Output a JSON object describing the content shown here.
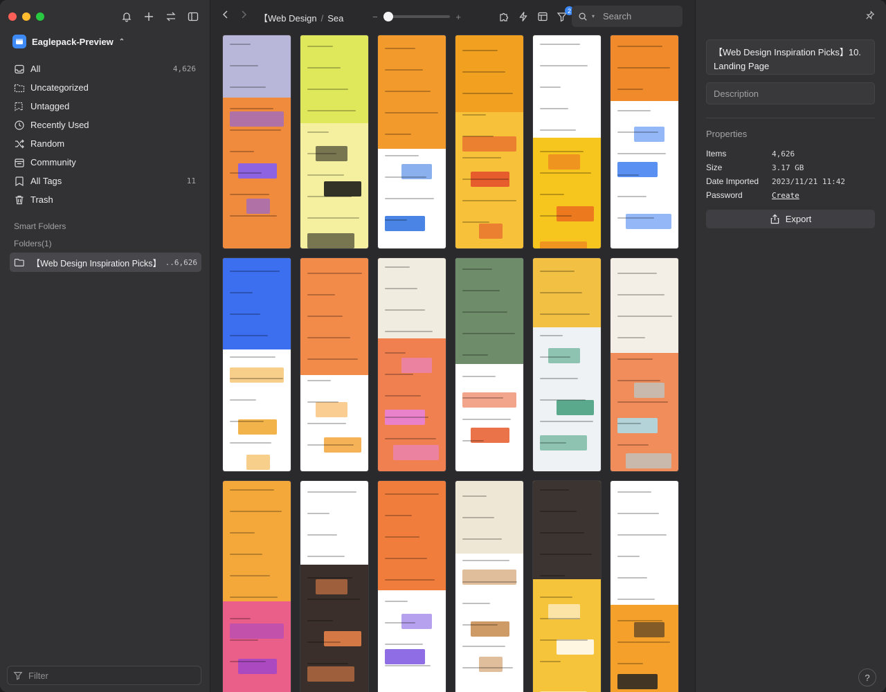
{
  "sidebar": {
    "library_name": "Eaglepack-Preview",
    "items": [
      {
        "label": "All",
        "count": "4,626",
        "icon": "inbox-icon"
      },
      {
        "label": "Uncategorized",
        "count": "",
        "icon": "folder-dashed-icon"
      },
      {
        "label": "Untagged",
        "count": "",
        "icon": "tag-dashed-icon"
      },
      {
        "label": "Recently Used",
        "count": "",
        "icon": "clock-icon"
      },
      {
        "label": "Random",
        "count": "",
        "icon": "shuffle-icon"
      },
      {
        "label": "Community",
        "count": "",
        "icon": "community-icon"
      },
      {
        "label": "All Tags",
        "count": "11",
        "icon": "tag-icon"
      },
      {
        "label": "Trash",
        "count": "",
        "icon": "trash-icon"
      }
    ],
    "smart_folders_label": "Smart Folders",
    "folders_label": "Folders(1)",
    "folder": {
      "label": "【Web Design Inspiration Picks】",
      "count": "..6,626"
    },
    "filter_placeholder": "Filter"
  },
  "toolbar": {
    "breadcrumb": [
      "【Web Design",
      "Sea"
    ],
    "zoom_level": 0.08,
    "filter_badge": "2",
    "search_placeholder": "Search"
  },
  "grid": {
    "thumbnails": [
      {
        "theme": [
          "#b9b7d9",
          "#f08a3c"
        ],
        "accent": "#7b5cff"
      },
      {
        "theme": [
          "#dfe85a",
          "#f5f0a0"
        ],
        "accent": "#111111"
      },
      {
        "theme": [
          "#f39a2c",
          "#ffffff"
        ],
        "accent": "#2a6fe0"
      },
      {
        "theme": [
          "#f2a020",
          "#f7c23a"
        ],
        "accent": "#e34a2a"
      },
      {
        "theme": [
          "#ffffff",
          "#f6c51e"
        ],
        "accent": "#ea6b1f"
      },
      {
        "theme": [
          "#f08a2a",
          "#ffffff"
        ],
        "accent": "#3c7cf0"
      },
      {
        "theme": [
          "#3b6ff0",
          "#ffffff"
        ],
        "accent": "#f0a62a"
      },
      {
        "theme": [
          "#f28a4a",
          "#ffffff"
        ],
        "accent": "#f5a53a"
      },
      {
        "theme": [
          "#f1ece0",
          "#f08050"
        ],
        "accent": "#e883e0"
      },
      {
        "theme": [
          "#6f8c6a",
          "#ffffff"
        ],
        "accent": "#e85b2a"
      },
      {
        "theme": [
          "#f2c144",
          "#eef2f5"
        ],
        "accent": "#3f9c7a"
      },
      {
        "theme": [
          "#f4efe6",
          "#f08d5a"
        ],
        "accent": "#a9dff0"
      },
      {
        "theme": [
          "#f5a83a",
          "#ea5e8a"
        ],
        "accent": "#a047c9"
      },
      {
        "theme": [
          "#ffffff",
          "#3a2f2a"
        ],
        "accent": "#f0864a"
      },
      {
        "theme": [
          "#f07d3c",
          "#ffffff"
        ],
        "accent": "#7a54e0"
      },
      {
        "theme": [
          "#efe7d5",
          "#ffffff"
        ],
        "accent": "#c6884a"
      },
      {
        "theme": [
          "#3c3430",
          "#f6c43a"
        ],
        "accent": "#ffffff"
      },
      {
        "theme": [
          "#ffffff",
          "#f5a02a"
        ],
        "accent": "#222222"
      }
    ]
  },
  "inspector": {
    "title": "【Web Design Inspiration Picks】10. Landing Page",
    "description_placeholder": "Description",
    "properties_label": "Properties",
    "props": [
      {
        "key": "Items",
        "value": "4,626"
      },
      {
        "key": "Size",
        "value": "3.17 GB"
      },
      {
        "key": "Date Imported",
        "value": "2023/11/21 11:42"
      },
      {
        "key": "Password",
        "value": "Create"
      }
    ],
    "export_label": "Export",
    "help_label": "?"
  }
}
